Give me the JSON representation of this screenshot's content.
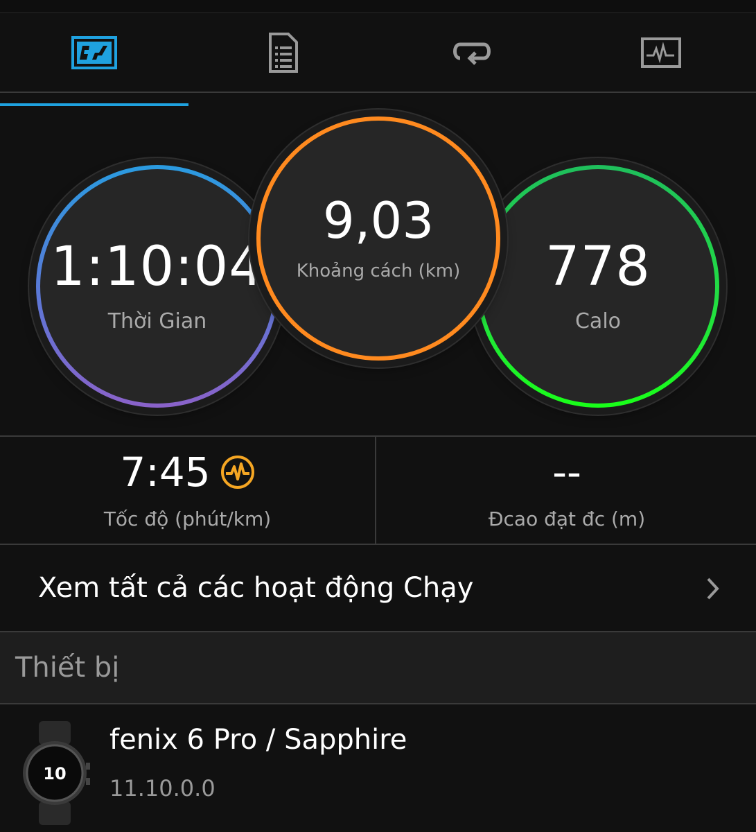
{
  "tabs": [
    {
      "icon": "stats-chart-icon",
      "selected": true
    },
    {
      "icon": "document-list-icon",
      "selected": false
    },
    {
      "icon": "repeat-icon",
      "selected": false
    },
    {
      "icon": "activity-graph-icon",
      "selected": false
    }
  ],
  "colors": {
    "accent_blue": "#1fa2e0",
    "time_ring": "#2a9be0",
    "distance_ring": "#ff8a1f",
    "calories_ring": "#22e040",
    "pace_icon": "#f5a623"
  },
  "stats": {
    "time": {
      "value": "1:10:04",
      "label": "Thời Gian"
    },
    "distance": {
      "value": "9,03",
      "label": "Khoảng cách (km)"
    },
    "calories": {
      "value": "778",
      "label": "Calo"
    }
  },
  "metrics": {
    "pace": {
      "value": "7:45",
      "label": "Tốc độ (phút/km)",
      "icon": "heart-rate-icon"
    },
    "elevation": {
      "value": "--",
      "label": "Đcao đạt đc (m)"
    }
  },
  "view_all": {
    "label": "Xem tất cả các hoạt động Chạy"
  },
  "devices_section": {
    "title": "Thiết bị"
  },
  "device": {
    "name": "fenix 6 Pro / Sapphire",
    "version": "11.10.0.0",
    "watch_face_number": "10"
  }
}
